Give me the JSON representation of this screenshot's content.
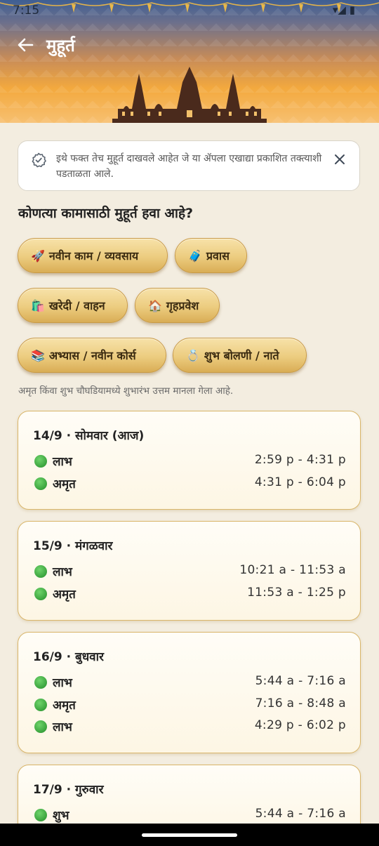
{
  "status": {
    "time": "7:15",
    "icons": "▾◢ ▮"
  },
  "header": {
    "title": "मुहूर्त"
  },
  "notice": {
    "text": "इथे फक्त तेच मुहूर्त दाखवले आहेत जे या ॲपला एखाद्या प्रकाशित तक्त्याशी पडताळता आले."
  },
  "question": "कोणत्या कामासाठी मुहूर्त हवा आहे?",
  "chips": [
    {
      "icon": "🚀",
      "label": "नवीन काम / व्यवसाय"
    },
    {
      "icon": "🧳",
      "label": "प्रवास"
    },
    {
      "icon": "🛍️",
      "label": "खरेदी / वाहन"
    },
    {
      "icon": "🏠",
      "label": "गृहप्रवेश"
    },
    {
      "icon": "📚",
      "label": "अभ्यास / नवीन कोर्स"
    },
    {
      "icon": "💍",
      "label": "शुभ बोलणी / नाते"
    }
  ],
  "hint": "अमृत किंवा शुभ चौघडियामध्ये शुभारंभ उत्तम मानला गेला आहे.",
  "days": [
    {
      "date": "14/9 · सोमवार (आज)",
      "slots": [
        {
          "name": "लाभ",
          "time": "2:59 p - 4:31 p"
        },
        {
          "name": "अमृत",
          "time": "4:31 p - 6:04 p"
        }
      ]
    },
    {
      "date": "15/9 · मंगळवार",
      "slots": [
        {
          "name": "लाभ",
          "time": "10:21 a - 11:53 a"
        },
        {
          "name": "अमृत",
          "time": "11:53 a - 1:25 p"
        }
      ]
    },
    {
      "date": "16/9 · बुधवार",
      "slots": [
        {
          "name": "लाभ",
          "time": "5:44 a - 7:16 a"
        },
        {
          "name": "अमृत",
          "time": "7:16 a - 8:48 a"
        },
        {
          "name": "लाभ",
          "time": "4:29 p - 6:02 p"
        }
      ]
    },
    {
      "date": "17/9 · गुरुवार",
      "slots": [
        {
          "name": "शुभ",
          "time": "5:44 a - 7:16 a"
        }
      ]
    }
  ]
}
